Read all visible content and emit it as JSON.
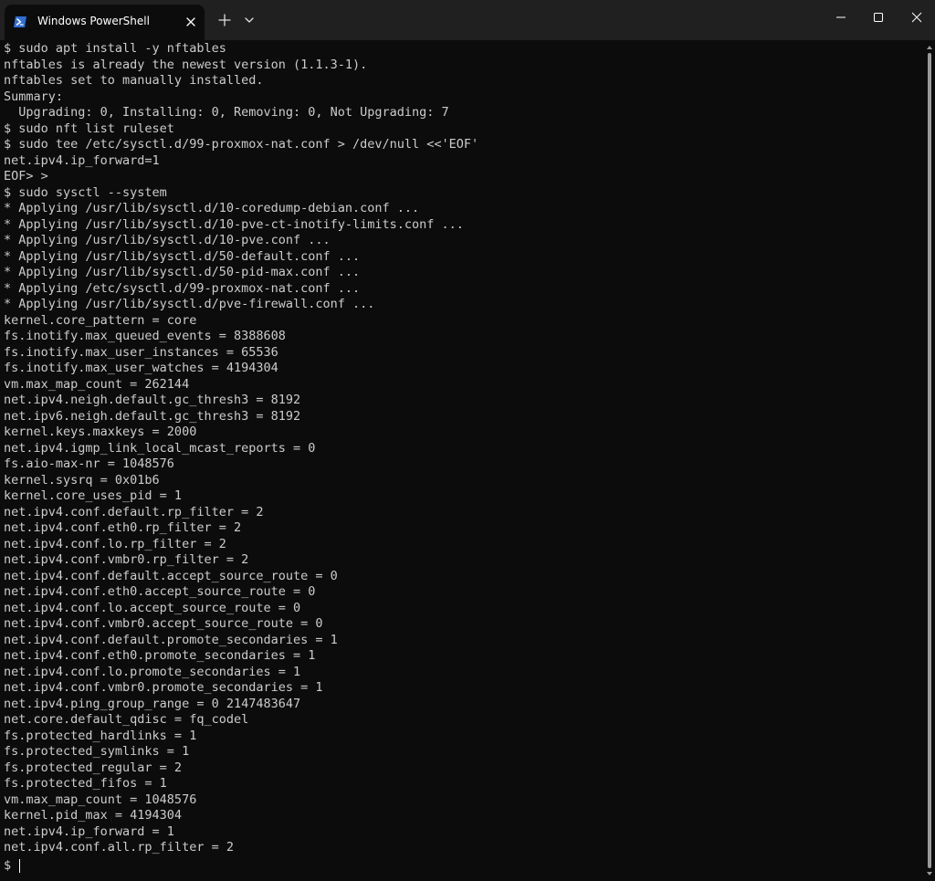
{
  "window": {
    "tab_title": "Windows PowerShell",
    "new_tab_symbol": "+",
    "colors": {
      "titlebar": "#202020",
      "terminal_bg": "#0c0c0c",
      "terminal_fg": "#cccccc",
      "icon_blue": "#2f6fd6"
    }
  },
  "terminal": {
    "lines": [
      "$ sudo apt install -y nftables",
      "nftables is already the newest version (1.1.3-1).",
      "nftables set to manually installed.",
      "Summary:",
      "  Upgrading: 0, Installing: 0, Removing: 0, Not Upgrading: 7",
      "$ sudo nft list ruleset",
      "$ sudo tee /etc/sysctl.d/99-proxmox-nat.conf > /dev/null <<'EOF'",
      "net.ipv4.ip_forward=1",
      "EOF> >",
      "$ sudo sysctl --system",
      "* Applying /usr/lib/sysctl.d/10-coredump-debian.conf ...",
      "* Applying /usr/lib/sysctl.d/10-pve-ct-inotify-limits.conf ...",
      "* Applying /usr/lib/sysctl.d/10-pve.conf ...",
      "* Applying /usr/lib/sysctl.d/50-default.conf ...",
      "* Applying /usr/lib/sysctl.d/50-pid-max.conf ...",
      "* Applying /etc/sysctl.d/99-proxmox-nat.conf ...",
      "* Applying /usr/lib/sysctl.d/pve-firewall.conf ...",
      "kernel.core_pattern = core",
      "fs.inotify.max_queued_events = 8388608",
      "fs.inotify.max_user_instances = 65536",
      "fs.inotify.max_user_watches = 4194304",
      "vm.max_map_count = 262144",
      "net.ipv4.neigh.default.gc_thresh3 = 8192",
      "net.ipv6.neigh.default.gc_thresh3 = 8192",
      "kernel.keys.maxkeys = 2000",
      "net.ipv4.igmp_link_local_mcast_reports = 0",
      "fs.aio-max-nr = 1048576",
      "kernel.sysrq = 0x01b6",
      "kernel.core_uses_pid = 1",
      "net.ipv4.conf.default.rp_filter = 2",
      "net.ipv4.conf.eth0.rp_filter = 2",
      "net.ipv4.conf.lo.rp_filter = 2",
      "net.ipv4.conf.vmbr0.rp_filter = 2",
      "net.ipv4.conf.default.accept_source_route = 0",
      "net.ipv4.conf.eth0.accept_source_route = 0",
      "net.ipv4.conf.lo.accept_source_route = 0",
      "net.ipv4.conf.vmbr0.accept_source_route = 0",
      "net.ipv4.conf.default.promote_secondaries = 1",
      "net.ipv4.conf.eth0.promote_secondaries = 1",
      "net.ipv4.conf.lo.promote_secondaries = 1",
      "net.ipv4.conf.vmbr0.promote_secondaries = 1",
      "net.ipv4.ping_group_range = 0 2147483647",
      "net.core.default_qdisc = fq_codel",
      "fs.protected_hardlinks = 1",
      "fs.protected_symlinks = 1",
      "fs.protected_regular = 2",
      "fs.protected_fifos = 1",
      "vm.max_map_count = 1048576",
      "kernel.pid_max = 4194304",
      "net.ipv4.ip_forward = 1",
      "net.ipv4.conf.all.rp_filter = 2"
    ],
    "prompt": "$ "
  }
}
